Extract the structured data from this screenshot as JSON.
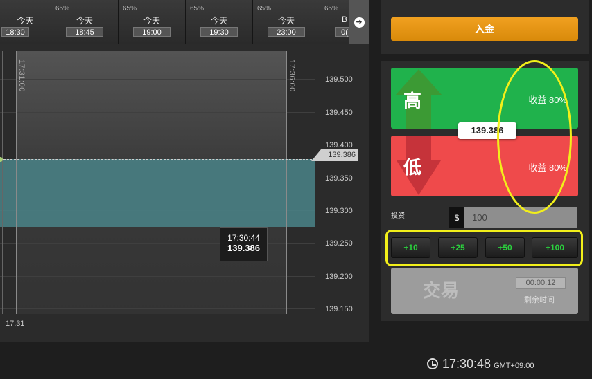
{
  "expiry_tabs": [
    {
      "percent": "",
      "day": "今天",
      "time": "18:30"
    },
    {
      "percent": "65%",
      "day": "今天",
      "time": "18:45"
    },
    {
      "percent": "65%",
      "day": "今天",
      "time": "19:00"
    },
    {
      "percent": "65%",
      "day": "今天",
      "time": "19:30"
    },
    {
      "percent": "65%",
      "day": "今天",
      "time": "23:00"
    },
    {
      "percent": "65%",
      "day": "B",
      "time": "0("
    }
  ],
  "scroll_icon": "arrow-right-icon",
  "chart": {
    "vlabel_start": "17:31:00",
    "vlabel_end": "17:36:00",
    "y_ticks": [
      "139.500",
      "139.450",
      "139.400",
      "139.350",
      "139.300",
      "139.250",
      "139.200",
      "139.150"
    ],
    "current_price": "139.386",
    "tooltip_time": "17:30:44",
    "tooltip_price": "139.386",
    "x_label": "17:31"
  },
  "deposit_label": "入金",
  "high": {
    "label": "高",
    "yield": "收益 80%"
  },
  "low": {
    "label": "低",
    "yield": "收益 80%"
  },
  "strike_price": "139.386",
  "investment": {
    "label": "投资",
    "currency": "$",
    "amount": "100"
  },
  "quick_amounts": [
    "+10",
    "+25",
    "+50",
    "+100"
  ],
  "trade": {
    "label": "交易",
    "timer": "00:00:12",
    "timer_label": "剩余时间"
  },
  "clock": {
    "time": "17:30:48",
    "tz": "GMT+09:00"
  },
  "colors": {
    "high": "#20b24c",
    "low": "#ef4a4b",
    "deposit": "#e39412",
    "highlight": "#f2ef1a",
    "quick_text": "#2bd03e"
  }
}
